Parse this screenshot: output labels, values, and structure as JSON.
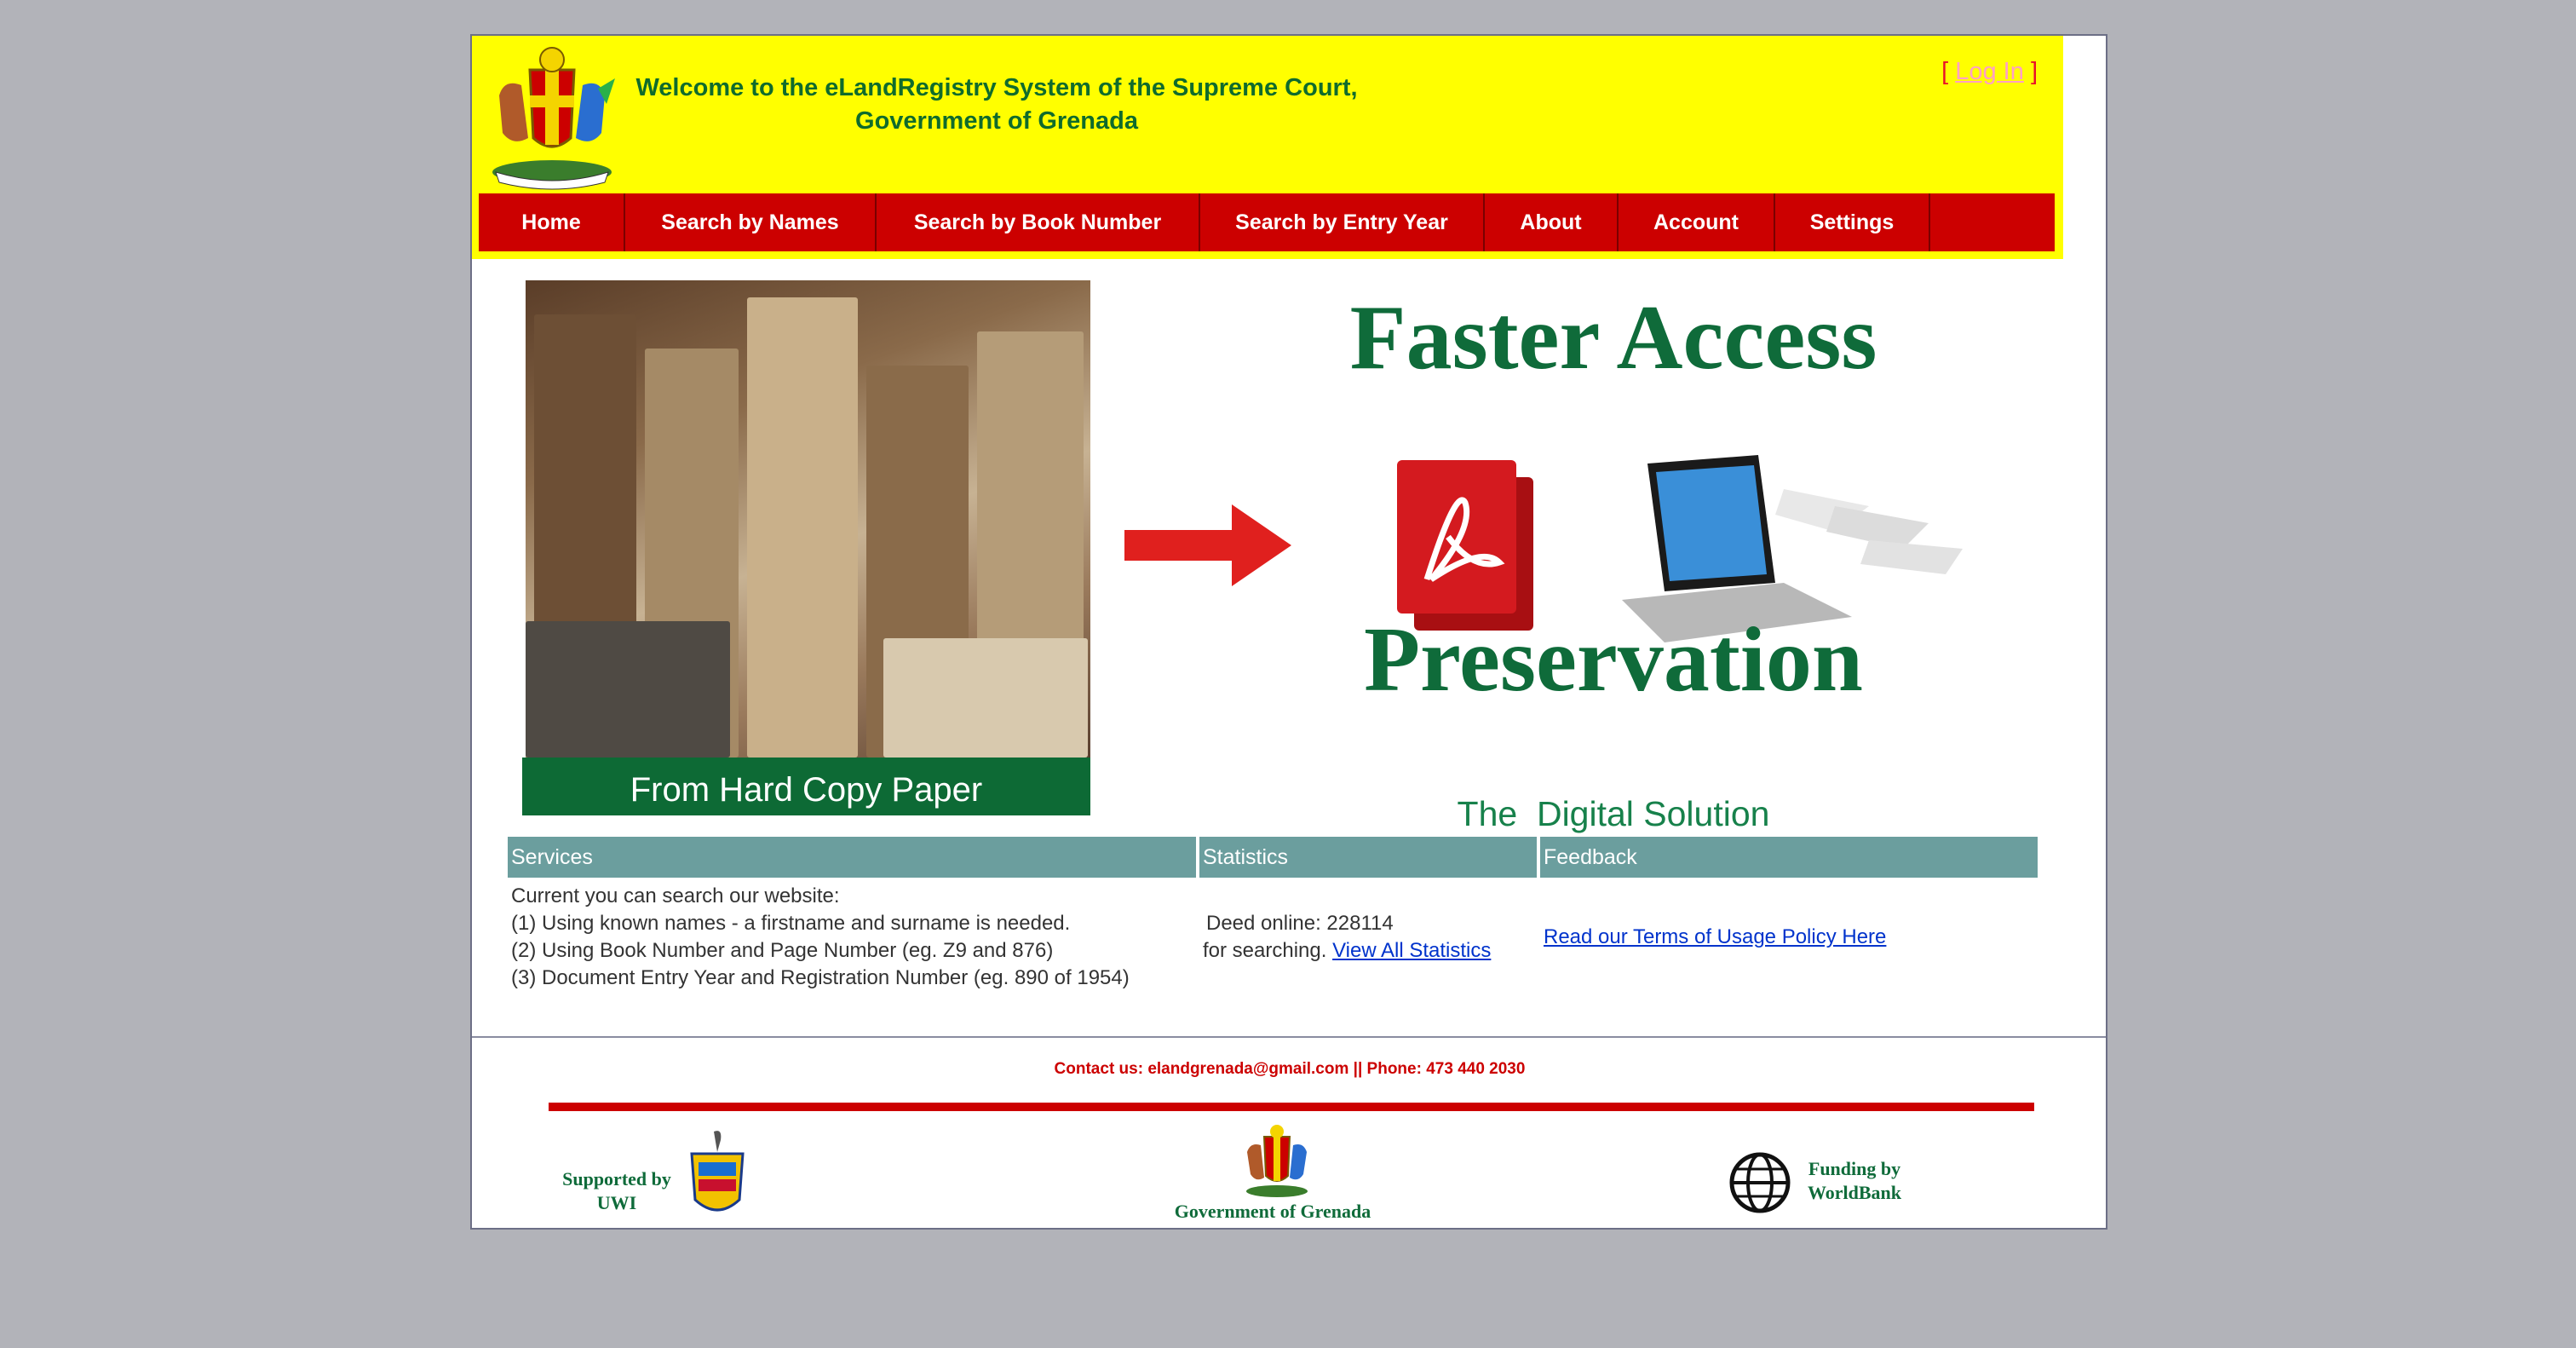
{
  "header": {
    "welcome_line1": "Welcome to the eLandRegistry System of the Supreme Court,",
    "welcome_line2": "Government of Grenada",
    "login_open": "[",
    "login_label": "Log In",
    "login_close": "]"
  },
  "nav": {
    "items": [
      {
        "label": "Home"
      },
      {
        "label": "Search by Names"
      },
      {
        "label": "Search by Book Number"
      },
      {
        "label": "Search by Entry Year"
      },
      {
        "label": "About"
      },
      {
        "label": "Account"
      },
      {
        "label": "Settings"
      }
    ]
  },
  "banner": {
    "caption": "From Hard Copy Paper",
    "faster": "Faster Access",
    "preservation": "Preservation",
    "digital": "The  Digital Solution"
  },
  "services": {
    "title": "Services",
    "lines": [
      "Current you can search our website:",
      "(1) Using known names - a firstname and surname is needed.",
      "(2) Using Book Number and Page Number (eg. Z9 and 876)",
      "(3) Document Entry Year and Registration Number (eg. 890 of 1954)"
    ]
  },
  "statistics": {
    "title": "Statistics",
    "deed_line": "Deed online: 228114",
    "search_prefix": "for searching.",
    "link": "View All Statistics"
  },
  "feedback": {
    "title": "Feedback",
    "link": "Read our Terms of Usage Policy Here"
  },
  "footer": {
    "contact": "Contact us: elandgrenada@gmail.com || Phone: 473 440 2030",
    "uwi_line1": "Supported by",
    "uwi_line2": "UWI",
    "gov": "Government of Grenada",
    "wb_line1": "Funding by",
    "wb_line2": "WorldBank"
  },
  "colors": {
    "header_bg": "#ffff00",
    "nav_bg": "#cc0000",
    "panel_header_bg": "#6b9e9e",
    "brand_green": "#0f6b3a",
    "link": "#0033cc"
  }
}
